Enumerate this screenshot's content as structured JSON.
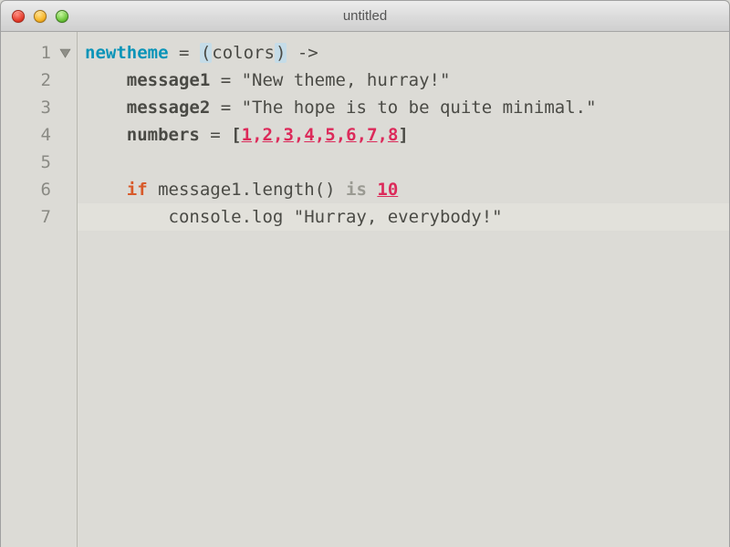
{
  "window": {
    "title": "untitled"
  },
  "gutter": {
    "lines": [
      "1",
      "2",
      "3",
      "4",
      "5",
      "6",
      "7"
    ]
  },
  "code": {
    "l1": {
      "kw": "newtheme",
      "eq": " = ",
      "lp": "(",
      "param": "colors",
      "rp": ")",
      "arrow": " ->"
    },
    "l2": {
      "indent": "    ",
      "var": "message1",
      "eq": " = ",
      "str": "\"New theme, hurray!\""
    },
    "l3": {
      "indent": "    ",
      "var": "message2",
      "eq": " = ",
      "str": "\"The hope is to be quite minimal.\""
    },
    "l4": {
      "indent": "    ",
      "var": "numbers",
      "eq": " = ",
      "lb": "[",
      "n1": "1",
      "c1": ",",
      "n2": "2",
      "c2": ",",
      "n3": "3",
      "c3": ",",
      "n4": "4",
      "c4": ",",
      "n5": "5",
      "c5": ",",
      "n6": "6",
      "c6": ",",
      "n7": "7",
      "c7": ",",
      "n8": "8",
      "rb": "]"
    },
    "l6": {
      "indent": "    ",
      "if": "if",
      "sp": " ",
      "expr": "message1.length()",
      "sp2": " ",
      "is": "is",
      "sp3": " ",
      "num": "10"
    },
    "l7": {
      "indent": "        ",
      "expr": "console.log ",
      "str": "\"Hurray, everybody!\""
    }
  }
}
